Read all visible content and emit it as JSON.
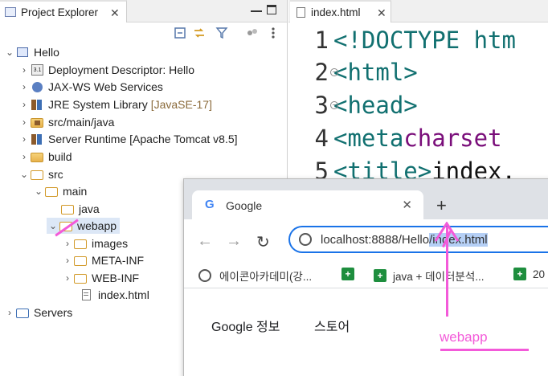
{
  "explorer": {
    "tab_label": "Project Explorer",
    "close": "✕",
    "tree": [
      {
        "label": "Hello",
        "deco": "",
        "icon": "project-icon"
      },
      {
        "label": "Deployment Descriptor: Hello",
        "deco": "",
        "icon": "descriptor-icon"
      },
      {
        "label": "JAX-WS Web Services",
        "deco": "",
        "icon": "webservices-icon"
      },
      {
        "label": "JRE System Library",
        "deco": "[JavaSE-17]",
        "icon": "library-icon"
      },
      {
        "label": "src/main/java",
        "deco": "",
        "icon": "source-folder-icon"
      },
      {
        "label": "Server Runtime [Apache Tomcat v8.5]",
        "deco": "",
        "icon": "library-icon"
      },
      {
        "label": "build",
        "deco": "",
        "icon": "folder-icon"
      },
      {
        "label": "src",
        "deco": "",
        "icon": "folder-icon"
      },
      {
        "label": "main",
        "deco": "",
        "icon": "folder-icon"
      },
      {
        "label": "java",
        "deco": "",
        "icon": "folder-icon"
      },
      {
        "label": "webapp",
        "deco": "",
        "icon": "folder-icon"
      },
      {
        "label": "images",
        "deco": "",
        "icon": "folder-icon"
      },
      {
        "label": "META-INF",
        "deco": "",
        "icon": "folder-icon"
      },
      {
        "label": "WEB-INF",
        "deco": "",
        "icon": "folder-icon"
      },
      {
        "label": "index.html",
        "deco": "",
        "icon": "file-icon"
      },
      {
        "label": "Servers",
        "deco": "",
        "icon": "folder-icon"
      }
    ]
  },
  "editor": {
    "tab_label": "index.html",
    "close": "✕",
    "lines": [
      {
        "num": "1",
        "a": "<!DOCTYPE htm",
        "b": "",
        "c": ""
      },
      {
        "num": "2",
        "a": "<html>",
        "b": "",
        "c": ""
      },
      {
        "num": "3",
        "a": "<head>",
        "b": "",
        "c": ""
      },
      {
        "num": "4",
        "a": "<meta ",
        "b": "charset",
        "c": ""
      },
      {
        "num": "5",
        "a": "<title>",
        "b": "",
        "c": "index."
      }
    ]
  },
  "browser": {
    "tab_title": "Google",
    "tab_close": "✕",
    "new_tab": "+",
    "url_host": "localhost:8888/Hello",
    "url_sep": "/",
    "url_path": "index.html",
    "bookmarks": [
      "에이콘아카데미(강...",
      "java + 데이터분석...",
      "20"
    ],
    "links": [
      "Google 정보",
      "스토어"
    ]
  },
  "annotation": {
    "text": "webapp",
    "color": "#f35ad9"
  }
}
